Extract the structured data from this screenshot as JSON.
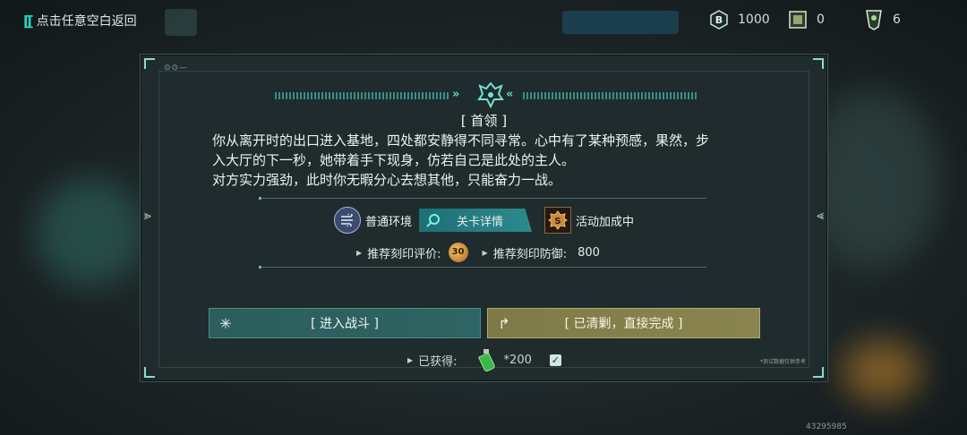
{
  "topbar": {
    "back_label": "点击任意空白返回",
    "resources": [
      {
        "icon": "b-coin-icon",
        "value": "1000"
      },
      {
        "icon": "card-icon",
        "value": "0"
      },
      {
        "icon": "ticket-icon",
        "value": "6"
      }
    ]
  },
  "dialog": {
    "title": "[ 首领 ]",
    "story": [
      "你从离开时的出口进入基地，四处都安静得不同寻常。心中有了某种预感，果然，步",
      "入大厅的下一秒，她带着手下现身，仿若自己是此处的主人。",
      "对方实力强劲，此时你无暇分心去想其他，只能奋力一战。"
    ],
    "tags": {
      "environment": "普通环境",
      "details": "关卡详情",
      "event": "活动加成中"
    },
    "recommend": {
      "rating_label": "推荐刻印评价:",
      "rating_value": "30",
      "defense_label": "推荐刻印防御:",
      "defense_value": "800"
    },
    "buttons": {
      "fight": "[ 进入战斗 ]",
      "clear": "[ 已清剿，直接完成 ]"
    },
    "earned": {
      "label": "已获得:",
      "qty": "*200"
    },
    "fine_print": "*测试数据仅供参考"
  },
  "footer_id": "43295985",
  "colors": {
    "accent": "#29d3c0",
    "fight_button": "#2e6463",
    "clear_button": "#8a8550"
  }
}
